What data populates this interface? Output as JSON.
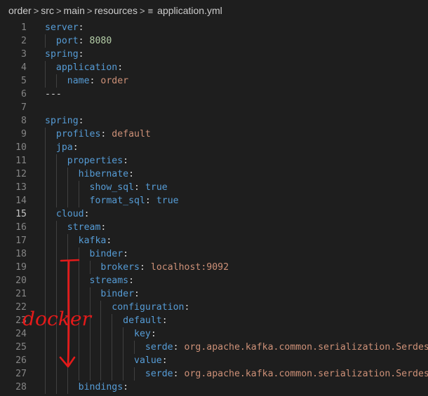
{
  "breadcrumb": {
    "parts": [
      "order",
      "src",
      "main",
      "resources",
      "application.yml"
    ],
    "separator": ">",
    "file_icon": "lines-file-icon"
  },
  "annotation": {
    "text": "docker",
    "color": "#e51a1a"
  },
  "colors": {
    "background": "#1e1e1e",
    "key": "#569cd6",
    "string": "#ce9178",
    "number": "#b5cea8",
    "punctuation": "#d4d4d4",
    "line_number": "#858585"
  },
  "editor": {
    "active_line": 15,
    "lines": [
      {
        "n": 1,
        "indent": 0,
        "tokens": [
          {
            "t": "server",
            "c": "k"
          },
          {
            "t": ":",
            "c": "p"
          }
        ]
      },
      {
        "n": 2,
        "indent": 1,
        "tokens": [
          {
            "t": "port",
            "c": "k"
          },
          {
            "t": ": ",
            "c": "p"
          },
          {
            "t": "8080",
            "c": "n"
          }
        ]
      },
      {
        "n": 3,
        "indent": 0,
        "tokens": [
          {
            "t": "spring",
            "c": "k"
          },
          {
            "t": ":",
            "c": "p"
          }
        ]
      },
      {
        "n": 4,
        "indent": 1,
        "tokens": [
          {
            "t": "application",
            "c": "k"
          },
          {
            "t": ":",
            "c": "p"
          }
        ]
      },
      {
        "n": 5,
        "indent": 2,
        "tokens": [
          {
            "t": "name",
            "c": "k"
          },
          {
            "t": ": ",
            "c": "p"
          },
          {
            "t": "order",
            "c": "s"
          }
        ]
      },
      {
        "n": 6,
        "indent": 0,
        "tokens": [
          {
            "t": "---",
            "c": "p"
          }
        ]
      },
      {
        "n": 7,
        "indent": 0,
        "tokens": []
      },
      {
        "n": 8,
        "indent": 0,
        "tokens": [
          {
            "t": "spring",
            "c": "k"
          },
          {
            "t": ":",
            "c": "p"
          }
        ]
      },
      {
        "n": 9,
        "indent": 1,
        "tokens": [
          {
            "t": "profiles",
            "c": "k"
          },
          {
            "t": ": ",
            "c": "p"
          },
          {
            "t": "default",
            "c": "s"
          }
        ]
      },
      {
        "n": 10,
        "indent": 1,
        "tokens": [
          {
            "t": "jpa",
            "c": "k"
          },
          {
            "t": ":",
            "c": "p"
          }
        ]
      },
      {
        "n": 11,
        "indent": 2,
        "tokens": [
          {
            "t": "properties",
            "c": "k"
          },
          {
            "t": ":",
            "c": "p"
          }
        ]
      },
      {
        "n": 12,
        "indent": 3,
        "tokens": [
          {
            "t": "hibernate",
            "c": "k"
          },
          {
            "t": ":",
            "c": "p"
          }
        ]
      },
      {
        "n": 13,
        "indent": 4,
        "tokens": [
          {
            "t": "show_sql",
            "c": "k"
          },
          {
            "t": ": ",
            "c": "p"
          },
          {
            "t": "true",
            "c": "k"
          }
        ]
      },
      {
        "n": 14,
        "indent": 4,
        "tokens": [
          {
            "t": "format_sql",
            "c": "k"
          },
          {
            "t": ": ",
            "c": "p"
          },
          {
            "t": "true",
            "c": "k"
          }
        ]
      },
      {
        "n": 15,
        "indent": 1,
        "tokens": [
          {
            "t": "cloud",
            "c": "k"
          },
          {
            "t": ":",
            "c": "p"
          }
        ]
      },
      {
        "n": 16,
        "indent": 2,
        "tokens": [
          {
            "t": "stream",
            "c": "k"
          },
          {
            "t": ":",
            "c": "p"
          }
        ]
      },
      {
        "n": 17,
        "indent": 3,
        "tokens": [
          {
            "t": "kafka",
            "c": "k"
          },
          {
            "t": ":",
            "c": "p"
          }
        ]
      },
      {
        "n": 18,
        "indent": 4,
        "tokens": [
          {
            "t": "binder",
            "c": "k"
          },
          {
            "t": ":",
            "c": "p"
          }
        ]
      },
      {
        "n": 19,
        "indent": 5,
        "tokens": [
          {
            "t": "brokers",
            "c": "k"
          },
          {
            "t": ": ",
            "c": "p"
          },
          {
            "t": "localhost:9092",
            "c": "s"
          }
        ]
      },
      {
        "n": 20,
        "indent": 4,
        "tokens": [
          {
            "t": "streams",
            "c": "k"
          },
          {
            "t": ":",
            "c": "p"
          }
        ]
      },
      {
        "n": 21,
        "indent": 5,
        "tokens": [
          {
            "t": "binder",
            "c": "k"
          },
          {
            "t": ":",
            "c": "p"
          }
        ]
      },
      {
        "n": 22,
        "indent": 6,
        "tokens": [
          {
            "t": "configuration",
            "c": "k"
          },
          {
            "t": ":",
            "c": "p"
          }
        ]
      },
      {
        "n": 23,
        "indent": 7,
        "tokens": [
          {
            "t": "default",
            "c": "k"
          },
          {
            "t": ":",
            "c": "p"
          }
        ]
      },
      {
        "n": 24,
        "indent": 8,
        "tokens": [
          {
            "t": "key",
            "c": "k"
          },
          {
            "t": ":",
            "c": "p"
          }
        ]
      },
      {
        "n": 25,
        "indent": 9,
        "tokens": [
          {
            "t": "serde",
            "c": "k"
          },
          {
            "t": ": ",
            "c": "p"
          },
          {
            "t": "org.apache.kafka.common.serialization.Serdes$S",
            "c": "s"
          }
        ]
      },
      {
        "n": 26,
        "indent": 8,
        "tokens": [
          {
            "t": "value",
            "c": "k"
          },
          {
            "t": ":",
            "c": "p"
          }
        ]
      },
      {
        "n": 27,
        "indent": 9,
        "tokens": [
          {
            "t": "serde",
            "c": "k"
          },
          {
            "t": ": ",
            "c": "p"
          },
          {
            "t": "org.apache.kafka.common.serialization.Serdes$S",
            "c": "s"
          }
        ]
      },
      {
        "n": 28,
        "indent": 3,
        "tokens": [
          {
            "t": "bindings",
            "c": "k"
          },
          {
            "t": ":",
            "c": "p"
          }
        ]
      }
    ]
  }
}
